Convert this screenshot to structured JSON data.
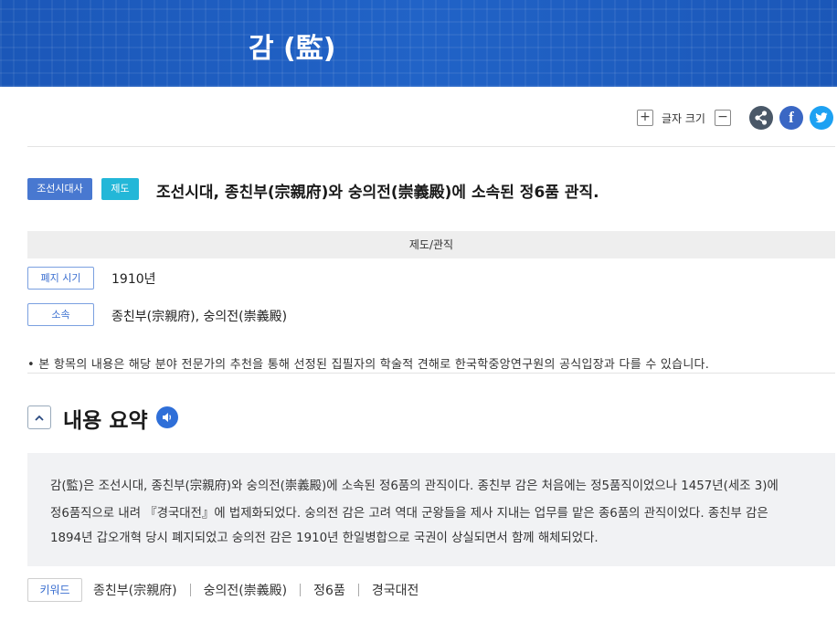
{
  "banner": {
    "title": "감 (監)"
  },
  "toolbar": {
    "font_size_label": "글자 크기",
    "plus": "+",
    "minus": "−",
    "facebook": "f"
  },
  "article": {
    "tags": [
      "조선시대사",
      "제도"
    ],
    "headline": "조선시대, 종친부(宗親府)와 숭의전(崇義殿)에 소속된 정6품 관직."
  },
  "info": {
    "category": "제도/관직",
    "fields": [
      {
        "label": "폐지 시기",
        "value": "1910년"
      },
      {
        "label": "소속",
        "value": "종친부(宗親府), 숭의전(崇義殿)"
      }
    ],
    "notice": "• 본 항목의 내용은 해당 분야 전문가의 추천을 통해 선정된 집필자의 학술적 견해로 한국학중앙연구원의 공식입장과 다를 수 있습니다."
  },
  "summary": {
    "title": "내용 요약",
    "lines": [
      "감(監)은 조선시대, 종친부(宗親府)와 숭의전(崇義殿)에 소속된 정6품의 관직이다. 종친부 감은 처음에는 정5품직이었으나 1457년(세조 3)에",
      "정6품직으로 내려 『경국대전』에 법제화되었다. 숭의전 감은 고려 역대 군왕들을 제사 지내는 업무를 맡은 종6품의 관직이었다. 종친부 감은",
      "1894년 갑오개혁 당시 폐지되었고 숭의전 감은 1910년 한일병합으로 국권이 상실되면서 함께 해체되었다."
    ]
  },
  "keywords": {
    "label": "키워드",
    "items": [
      "종친부(宗親府)",
      "숭의전(崇義殿)",
      "정6품",
      "경국대전"
    ]
  },
  "colors": {
    "banner_blue": "#1d5bbd",
    "tag_era": "#4878d0",
    "tag_category": "#23b7d8",
    "label_blue": "#3b6fd0"
  },
  "icons": [
    "plus-icon",
    "minus-icon",
    "share-icon",
    "facebook-icon",
    "twitter-icon",
    "chevron-up-icon",
    "speaker-icon"
  ]
}
